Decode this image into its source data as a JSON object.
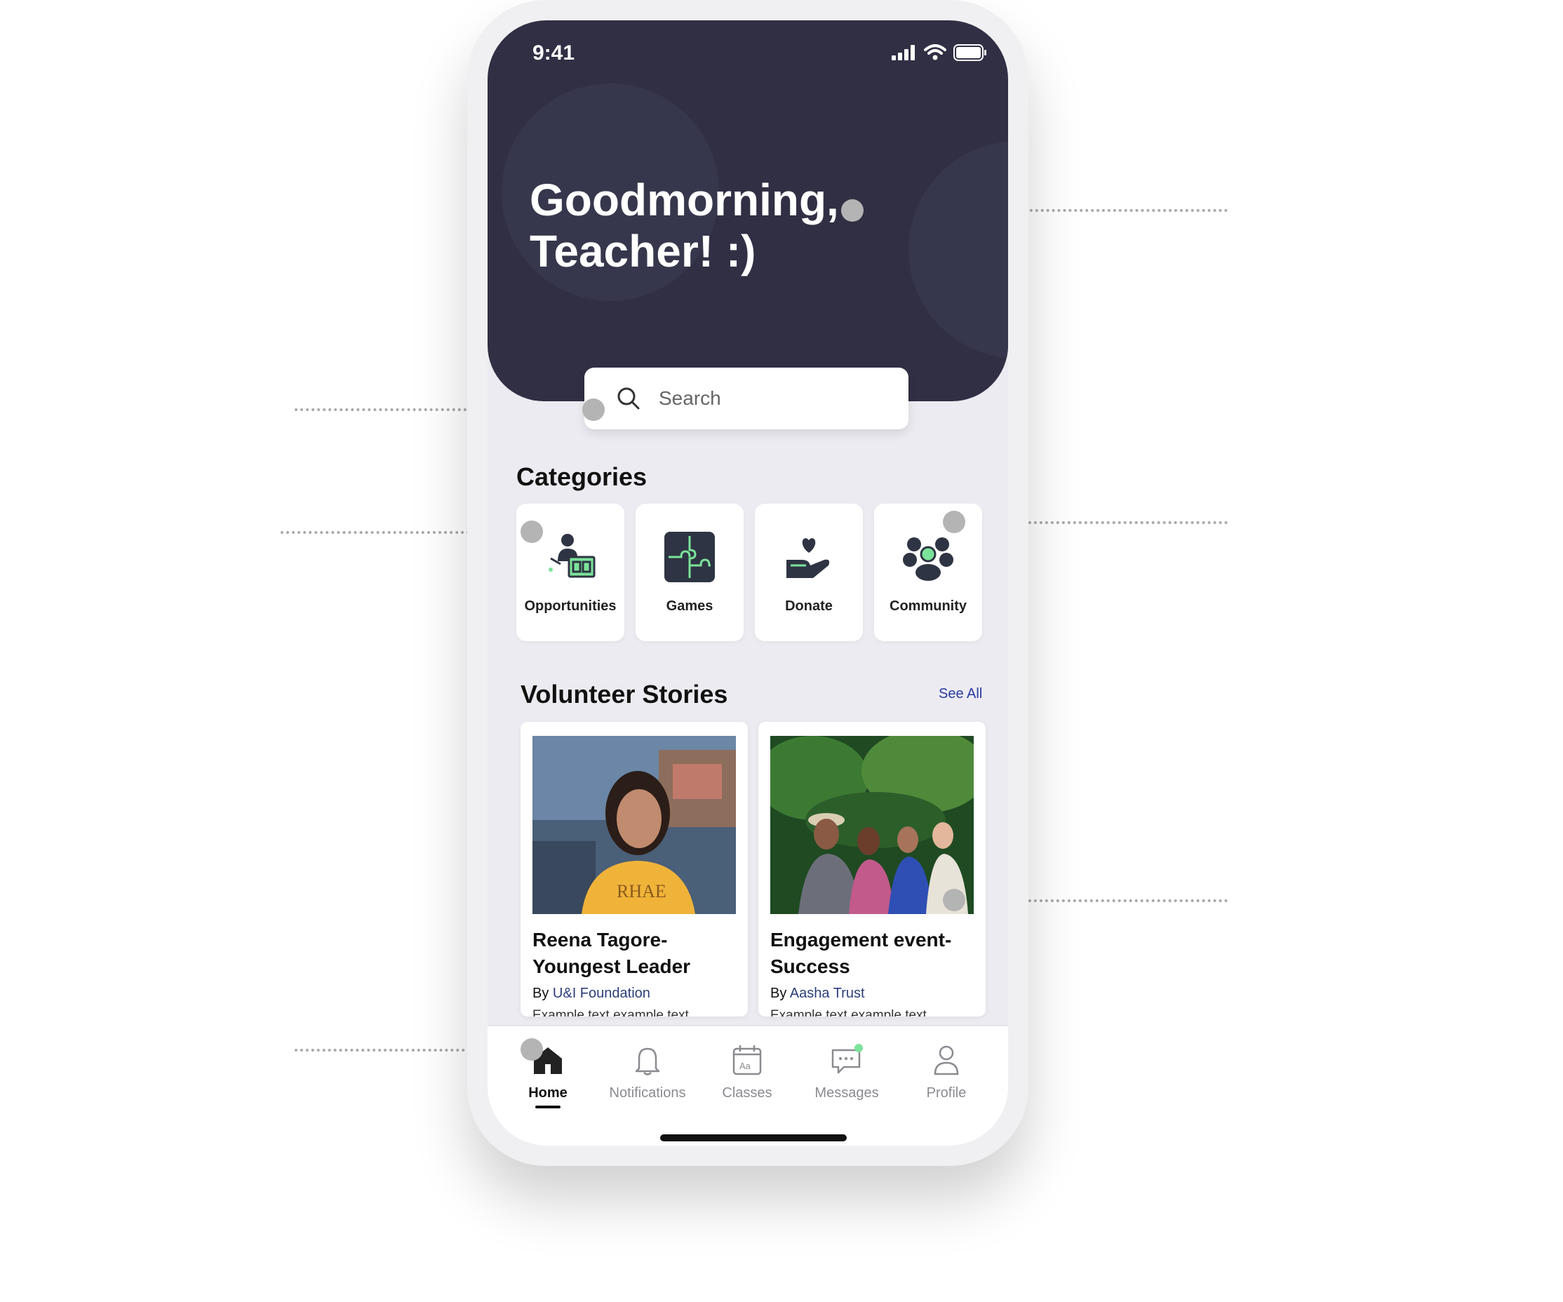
{
  "status": {
    "time": "9:41"
  },
  "header": {
    "greeting_line1": "Goodmorning,",
    "greeting_line2": "Teacher! :)"
  },
  "search": {
    "placeholder": "Search",
    "icon": "search-icon"
  },
  "categories": {
    "title": "Categories",
    "items": [
      {
        "label": "Opportunities",
        "icon": "teacher-board-icon"
      },
      {
        "label": "Games",
        "icon": "puzzle-icon"
      },
      {
        "label": "Donate",
        "icon": "hand-heart-icon"
      },
      {
        "label": "Community",
        "icon": "group-icon"
      }
    ]
  },
  "stories": {
    "title": "Volunteer Stories",
    "see_all": "See All",
    "items": [
      {
        "title": "Reena Tagore- Youngest Leader",
        "by": "By",
        "org": "U&I Foundation",
        "desc": "Example text example text"
      },
      {
        "title": "Engagement event- Success",
        "by": "By",
        "org": "Aasha Trust",
        "desc": "Example text example text"
      }
    ]
  },
  "tabs": [
    {
      "label": "Home",
      "icon": "home-icon",
      "active": true
    },
    {
      "label": "Notifications",
      "icon": "bell-icon"
    },
    {
      "label": "Classes",
      "icon": "calendar-icon"
    },
    {
      "label": "Messages",
      "icon": "chat-icon"
    },
    {
      "label": "Profile",
      "icon": "user-icon"
    }
  ],
  "colors": {
    "header": "#312f44",
    "accent_green": "#7be39a",
    "background": "#ecebf1",
    "link": "#2a3aa0"
  }
}
